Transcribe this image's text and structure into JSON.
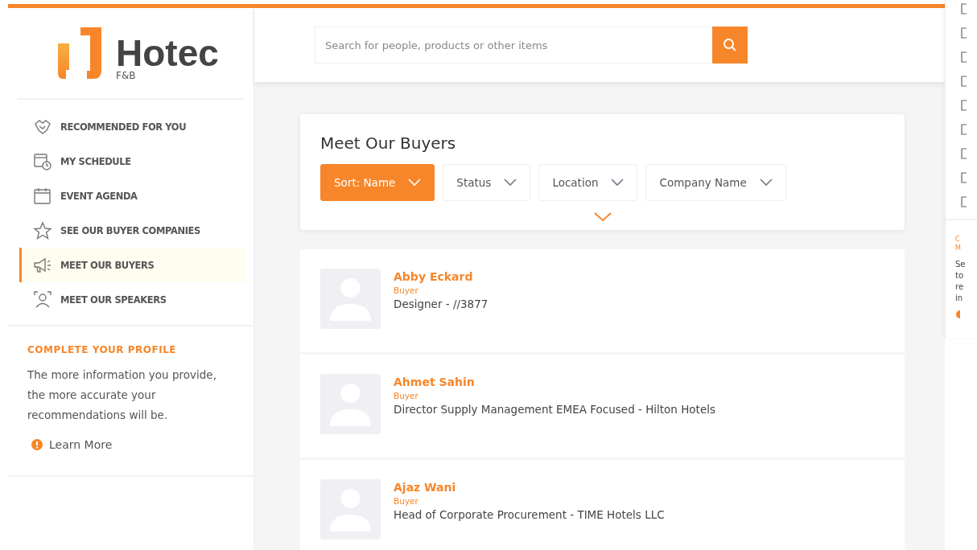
{
  "logo": {
    "name": "Hotec",
    "subtitle": "F&B"
  },
  "search": {
    "placeholder": "Search for people, products or other items"
  },
  "nav": [
    {
      "label": "RECOMMENDED FOR YOU",
      "selected": false
    },
    {
      "label": "MY SCHEDULE",
      "selected": false
    },
    {
      "label": "EVENT AGENDA",
      "selected": false
    },
    {
      "label": "SEE OUR BUYER COMPANIES",
      "selected": false
    },
    {
      "label": "MEET OUR BUYERS",
      "selected": true
    },
    {
      "label": "MEET OUR SPEAKERS",
      "selected": false
    }
  ],
  "profile": {
    "title": "COMPLETE YOUR PROFILE",
    "text": "The more information you provide, the more accurate your recommendations will be.",
    "link": "Learn More"
  },
  "page_title": "Meet Our Buyers",
  "filters": [
    {
      "label": "Sort: Name",
      "selected": true
    },
    {
      "label": "Status",
      "selected": false
    },
    {
      "label": "Location",
      "selected": false
    },
    {
      "label": "Company Name",
      "selected": false
    }
  ],
  "buyers": [
    {
      "name": "Abby Eckard",
      "role": "Buyer",
      "position": "Designer - //3877"
    },
    {
      "name": "Ahmet Sahin",
      "role": "Buyer",
      "position": "Director Supply Management EMEA Focused - Hilton Hotels"
    },
    {
      "name": "Ajaz Wani",
      "role": "Buyer",
      "position": "Head of Corporate Procurement - TIME Hotels LLC"
    }
  ],
  "side_panel": {
    "heading_lines": [
      "C",
      "M"
    ],
    "text_lines": [
      "Se",
      "to",
      "re",
      "in"
    ]
  }
}
